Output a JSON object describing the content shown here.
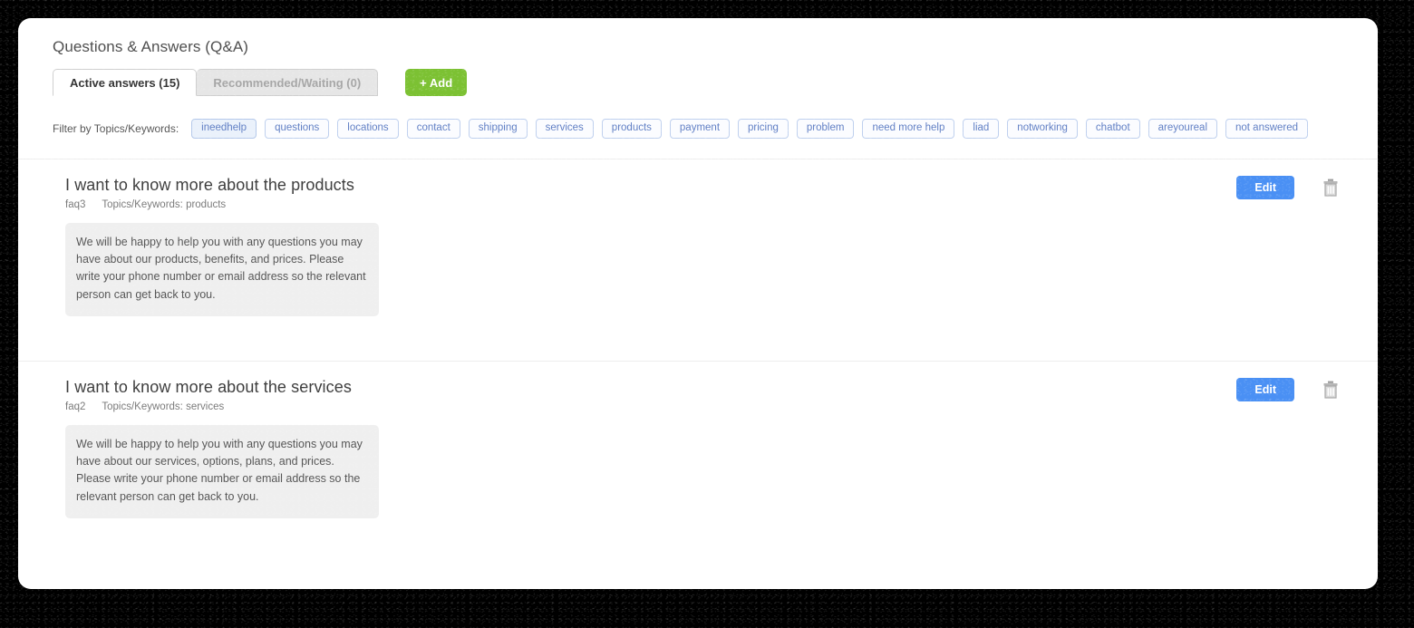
{
  "page": {
    "title": "Questions & Answers (Q&A)"
  },
  "tabs": [
    {
      "label": "Active answers (15)",
      "state": "active"
    },
    {
      "label": "Recommended/Waiting (0)",
      "state": "inactive"
    }
  ],
  "toolbar": {
    "add_label": "+ Add",
    "add_color": "#7cc133"
  },
  "filter": {
    "label": "Filter by Topics/Keywords:",
    "tags": [
      {
        "label": "ineedhelp",
        "selected": true
      },
      {
        "label": "questions",
        "selected": false
      },
      {
        "label": "locations",
        "selected": false
      },
      {
        "label": "contact",
        "selected": false
      },
      {
        "label": "shipping",
        "selected": false
      },
      {
        "label": "services",
        "selected": false
      },
      {
        "label": "products",
        "selected": false
      },
      {
        "label": "payment",
        "selected": false
      },
      {
        "label": "pricing",
        "selected": false
      },
      {
        "label": "problem",
        "selected": false
      },
      {
        "label": "need more help",
        "selected": false
      },
      {
        "label": "liad",
        "selected": false
      },
      {
        "label": "notworking",
        "selected": false
      },
      {
        "label": "chatbot",
        "selected": false
      },
      {
        "label": "areyoureal",
        "selected": false
      },
      {
        "label": "not answered",
        "selected": false
      }
    ]
  },
  "faqs": [
    {
      "question": "I want to know more about the products",
      "id": "faq3",
      "keywords": "Topics/Keywords: products",
      "answer": "We will be happy to help you with any questions you may have about our products, benefits, and prices. Please write your phone number or email address so the relevant person can get back to you.",
      "edit_label": "Edit",
      "delete_icon": "trash-icon"
    },
    {
      "question": "I want to know more about the services",
      "id": "faq2",
      "keywords": "Topics/Keywords: services",
      "answer": "We will be happy to help you with any questions you may have about our services, options, plans, and prices. Please write your phone number or email address so the relevant person can get back to you.",
      "edit_label": "Edit",
      "delete_icon": "trash-icon"
    }
  ],
  "colors": {
    "edit_button": "#4a90f4",
    "add_button": "#7cc133",
    "tag_text": "#5f7ec4",
    "answer_bg": "#efefef"
  }
}
